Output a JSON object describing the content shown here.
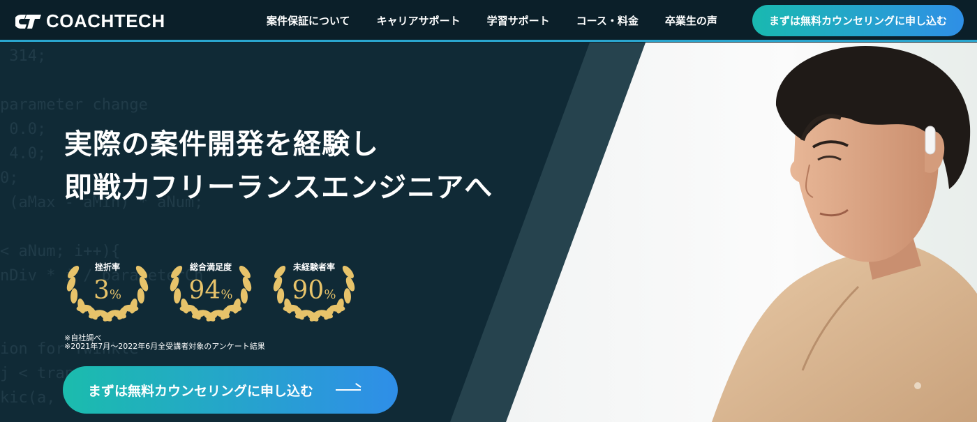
{
  "header": {
    "logo_text": "COACHTECH",
    "nav": [
      {
        "label": "案件保証について"
      },
      {
        "label": "キャリアサポート"
      },
      {
        "label": "学習サポート"
      },
      {
        "label": "コース・料金"
      },
      {
        "label": "卒業生の声"
      }
    ],
    "cta_label": "まずは無料カウンセリングに申し込む"
  },
  "hero": {
    "headline_line1": "実際の案件開発を経験し",
    "headline_line2": "即戦力フリーランスエンジニアへ",
    "awards": [
      {
        "label": "挫折率",
        "value": "3",
        "unit": "%"
      },
      {
        "label": "総合満足度",
        "value": "94",
        "unit": "%"
      },
      {
        "label": "未経験者率",
        "value": "90",
        "unit": "%"
      }
    ],
    "note_line1": "※自社調べ",
    "note_line2": "※2021年7月〜2022年6月全受講者対象のアンケート結果",
    "cta_label": "まずは無料カウンセリングに申し込む",
    "code_lines": [
      " 314;",
      "",
      "parameter change",
      " 0.0;",
      " 4.0;",
      "0;",
      " (aMax - aMin) * aNum;",
      "",
      "< aNum; i++){",
      "nDiv * i / parameterCh",
      "",
      "",
      "ion for Twinkle",
      "j < transition; j++",
      "kic(a, f"
    ]
  },
  "colors": {
    "accent_start": "#19b9b0",
    "accent_end": "#2f8fe6",
    "header_bg": "#0b1f29",
    "hero_bg": "#102a36",
    "award_gold": "#e7c36a"
  }
}
